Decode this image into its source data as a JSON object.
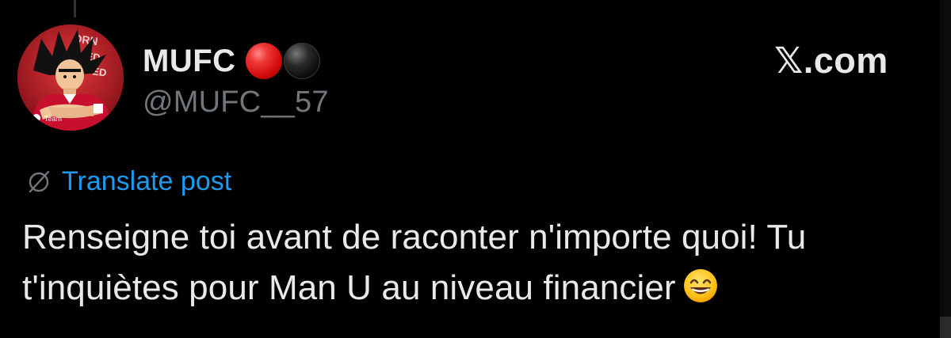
{
  "post": {
    "display_name": "MUFC",
    "handle": "@MUFC__57",
    "brand": "𝕏.com",
    "translate_label": "Translate post",
    "text_lines": [
      "Renseigne toi avant de raconter n'importe quoi! Tu",
      "t'inquiètes pour Man U au niveau financier"
    ],
    "emoji": "grinning-face-with-smiling-eyes",
    "name_badges": [
      "red-circle",
      "black-circle"
    ]
  },
  "colors": {
    "background": "#000000",
    "text_primary": "#e7e9ea",
    "text_secondary": "#71767b",
    "link": "#1d9bf0",
    "badge_red": "#d00a0a",
    "badge_black": "#0c0c0c"
  },
  "icons": {
    "translate": "globe-slash-icon",
    "avatar": "profile-avatar"
  }
}
